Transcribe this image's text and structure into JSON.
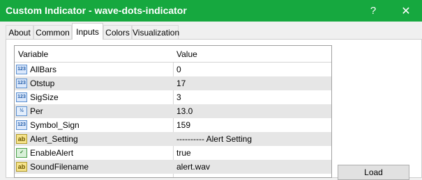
{
  "window": {
    "title": "Custom Indicator - wave-dots-indicator",
    "help_label": "?",
    "close_label": "✕"
  },
  "tabs": [
    {
      "label": "About"
    },
    {
      "label": "Common"
    },
    {
      "label": "Inputs",
      "active": true
    },
    {
      "label": "Colors"
    },
    {
      "label": "Visualization"
    }
  ],
  "table": {
    "headers": {
      "variable": "Variable",
      "value": "Value"
    },
    "rows": [
      {
        "icon": "int-icon",
        "icon_text": "123",
        "variable": "AllBars",
        "value": "0"
      },
      {
        "icon": "int-icon",
        "icon_text": "123",
        "variable": "Otstup",
        "value": "17"
      },
      {
        "icon": "int-icon",
        "icon_text": "123",
        "variable": "SigSize",
        "value": "3"
      },
      {
        "icon": "double-icon",
        "icon_text": "½",
        "variable": "Per",
        "value": "13.0"
      },
      {
        "icon": "int-icon",
        "icon_text": "123",
        "variable": "Symbol_Sign",
        "value": "159"
      },
      {
        "icon": "string-icon",
        "icon_text": "ab",
        "variable": "Alert_Setting",
        "value": "---------- Alert Setting"
      },
      {
        "icon": "bool-icon",
        "icon_text": "✓",
        "variable": "EnableAlert",
        "value": "true"
      },
      {
        "icon": "string-icon",
        "icon_text": "ab",
        "variable": "SoundFilename",
        "value": "alert.wav"
      }
    ]
  },
  "buttons": {
    "load_label": "Load"
  },
  "colors": {
    "titlebar": "#16a83f",
    "row_alt": "#e6e6e6"
  }
}
